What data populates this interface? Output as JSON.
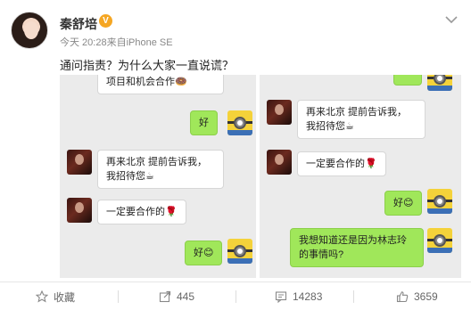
{
  "post": {
    "username": "秦舒培",
    "verified_glyph": "V",
    "meta": "今天 20:28来自iPhone SE",
    "text": "通问指责？为什么大家一直说谎？"
  },
  "left_chat": {
    "top_partial": "项目和机会合作",
    "msg_hao_1": "好",
    "msg_beijing": "再来北京 提前告诉我，我招待您",
    "msg_cooperate": "一定要合作的",
    "msg_hao_2": "好"
  },
  "right_chat": {
    "msg_beijing": "再来北京 提前告诉我，我招待您",
    "msg_cooperate": "一定要合作的",
    "msg_hao": "好",
    "msg_question": "我想知道还是因为林志玲的事情吗?"
  },
  "actions": {
    "favorite": "收藏",
    "repost": "445",
    "comment": "14283",
    "like": "3659"
  },
  "colors": {
    "accent": "#f5a623",
    "green_bubble": "#a0e75a",
    "chat_bg": "#ebebeb"
  }
}
